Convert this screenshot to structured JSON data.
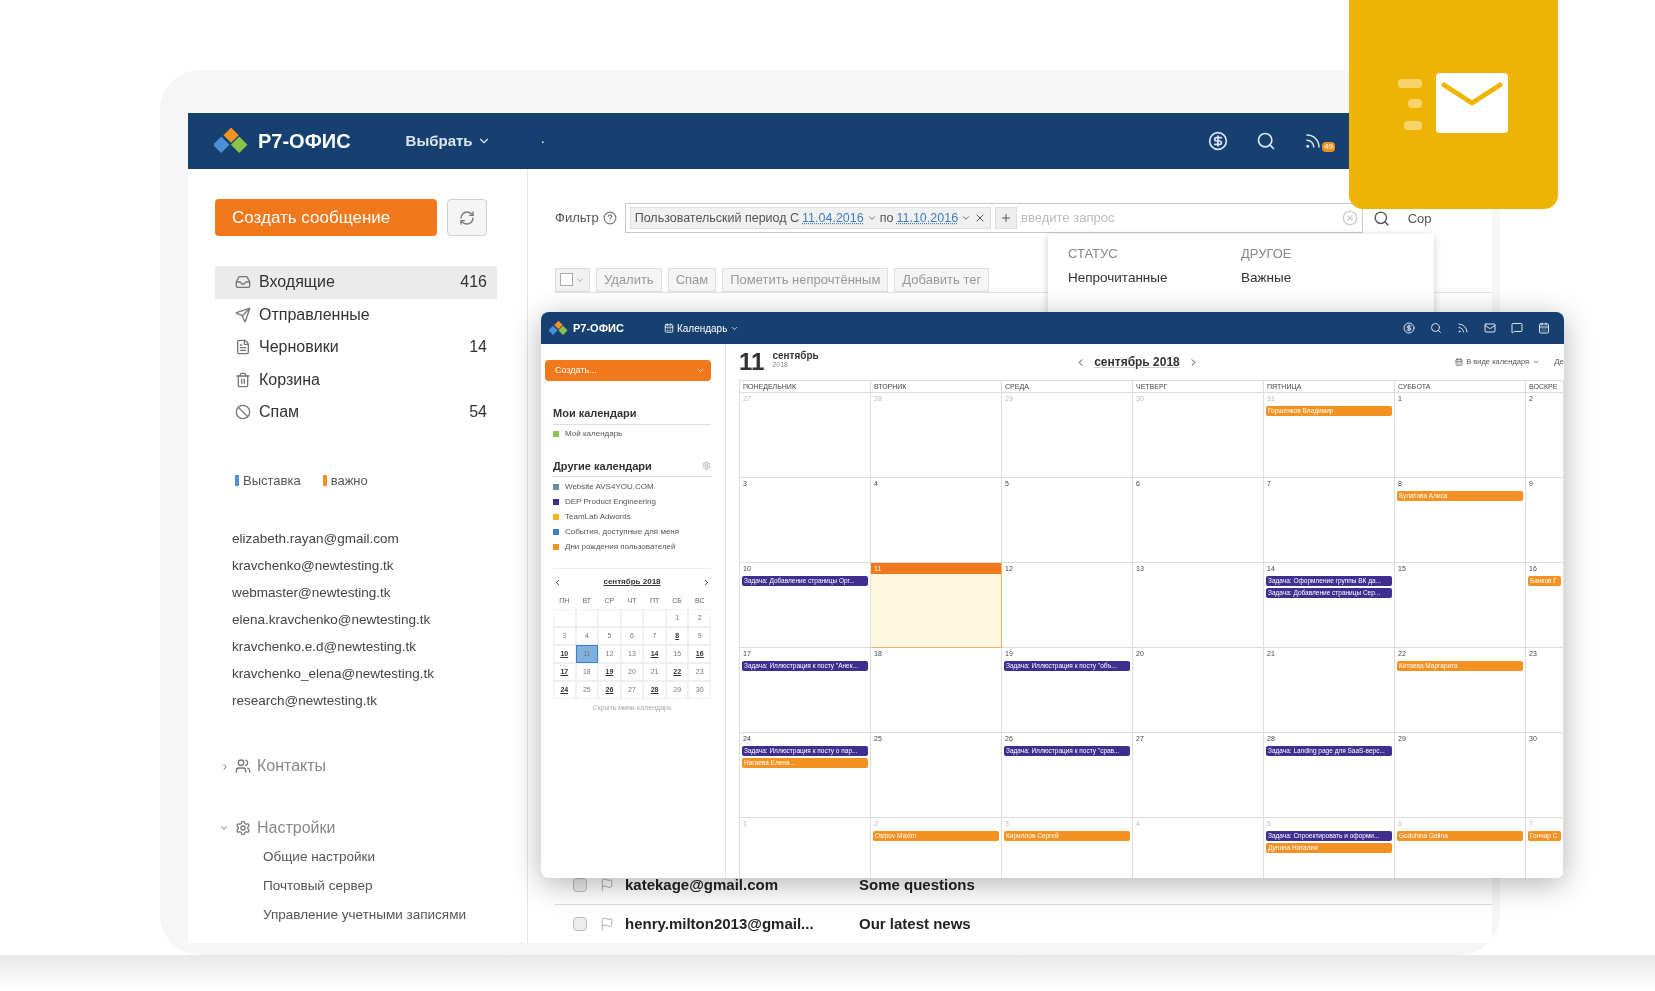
{
  "mail": {
    "header": {
      "logo": "Р7-ОФИС",
      "menu": "Выбрать",
      "dot": "·",
      "feed_badge": "49"
    },
    "sidebar": {
      "create_button": "Создать сообщение",
      "folders": [
        {
          "label": "Входящие",
          "count": "416",
          "selected": true,
          "kind": "inbox"
        },
        {
          "label": "Отправленные",
          "selected": false,
          "kind": "sent"
        },
        {
          "label": "Черновики",
          "count": "14",
          "selected": false,
          "kind": "drafts"
        },
        {
          "label": "Корзина",
          "selected": false,
          "kind": "trash"
        },
        {
          "label": "Спам",
          "count": "54",
          "selected": false,
          "kind": "spam"
        }
      ],
      "tags": [
        {
          "label": "Выставка",
          "color": "#4a90d9"
        },
        {
          "label": "важно",
          "color": "#f39220"
        }
      ],
      "accounts": [
        "elizabeth.rayan@gmail.com",
        "kravchenko@newtesting.tk",
        "webmaster@newtesting.tk",
        "elena.kravchenko@newtesting.tk",
        "kravchenko.e.d@newtesting.tk",
        "kravchenko_elena@newtesting.tk",
        "research@newtesting.tk"
      ],
      "sections": [
        {
          "label": "Контакты",
          "kind": "contacts",
          "expanded": false
        },
        {
          "label": "Настройки",
          "kind": "settings",
          "expanded": true,
          "children": [
            "Общие настройки",
            "Почтовый сервер",
            "Управление учетными записями"
          ]
        }
      ]
    },
    "filter": {
      "label": "Фильтр",
      "period": "Пользовательский период С",
      "from": "11.04.2016",
      "to_label": "по",
      "to": "11.10.2016",
      "placeholder": "введите запрос",
      "sort_label": "Сор"
    },
    "select_all": {
      "checked": false
    },
    "toolbar": [
      "Удалить",
      "Спам",
      "Пометить непрочтённым",
      "Добавить тег"
    ],
    "dropdown": {
      "columns": [
        {
          "title": "СТАТУС",
          "items": [
            "Непрочитанные"
          ]
        },
        {
          "title": "ДРУГОЕ",
          "items": [
            "Важные"
          ]
        }
      ]
    },
    "messages": [
      {
        "sender": "katekage@gmail.com",
        "subject": "Some questions",
        "checked": false
      },
      {
        "sender": "henry.milton2013@gmail...",
        "subject": "Our latest news",
        "checked": false
      }
    ]
  },
  "calendar": {
    "header": {
      "logo": "Р7-ОФИС",
      "menu": "Календарь"
    },
    "create_button": "Создать...",
    "my_calendars": {
      "title": "Мои календари",
      "items": [
        {
          "label": "Мой календарь",
          "color": "#8bc34a"
        }
      ]
    },
    "other_calendars": {
      "title": "Другие календари",
      "items": [
        {
          "label": "Website AVS4YOU.COM",
          "color": "#6b8e9e"
        },
        {
          "label": "DEP Product Engineering",
          "color": "#3f2d8f"
        },
        {
          "label": "TeamLab Adwords",
          "color": "#f5b21b"
        },
        {
          "label": "События, доступные для меня",
          "color": "#3d7fc4"
        },
        {
          "label": "Дни рождения пользователей",
          "color": "#f39220"
        }
      ]
    },
    "mini": {
      "title": "сентябрь 2018",
      "weekdays": [
        "ПН",
        "ВТ",
        "СР",
        "ЧТ",
        "ПТ",
        "СБ",
        "ВС"
      ],
      "weeks": [
        [
          {
            "d": "1",
            "marked": false,
            "selected": false
          },
          {
            "d": "2",
            "marked": false,
            "selected": false
          }
        ],
        [
          {
            "d": "3",
            "marked": false,
            "selected": false
          },
          {
            "d": "4",
            "marked": false,
            "selected": false
          },
          {
            "d": "5",
            "marked": false,
            "selected": false
          },
          {
            "d": "6",
            "marked": false,
            "selected": false
          },
          {
            "d": "7",
            "marked": false,
            "selected": false
          },
          {
            "d": "8",
            "marked": true,
            "selected": false
          },
          {
            "d": "9",
            "marked": false,
            "selected": false
          }
        ],
        [
          {
            "d": "10",
            "marked": true,
            "selected": false
          },
          {
            "d": "11",
            "marked": false,
            "selected": true
          },
          {
            "d": "12",
            "marked": false,
            "selected": false
          },
          {
            "d": "13",
            "marked": false,
            "selected": false
          },
          {
            "d": "14",
            "marked": true,
            "selected": false
          },
          {
            "d": "15",
            "marked": false,
            "selected": false
          },
          {
            "d": "16",
            "marked": true,
            "selected": false
          }
        ],
        [
          {
            "d": "17",
            "marked": true,
            "selected": false
          },
          {
            "d": "18",
            "marked": false,
            "selected": false
          },
          {
            "d": "19",
            "marked": true,
            "selected": false
          },
          {
            "d": "20",
            "marked": false,
            "selected": false
          },
          {
            "d": "21",
            "marked": false,
            "selected": false
          },
          {
            "d": "22",
            "marked": true,
            "selected": false
          },
          {
            "d": "23",
            "marked": false,
            "selected": false
          }
        ],
        [
          {
            "d": "24",
            "marked": true,
            "selected": false
          },
          {
            "d": "25",
            "marked": false,
            "selected": false
          },
          {
            "d": "26",
            "marked": true,
            "selected": false
          },
          {
            "d": "27",
            "marked": false,
            "selected": false
          },
          {
            "d": "28",
            "marked": true,
            "selected": false
          },
          {
            "d": "29",
            "marked": false,
            "selected": false
          },
          {
            "d": "30",
            "marked": false,
            "selected": false
          }
        ]
      ],
      "hide_link": "Скрыть мини-календарь"
    },
    "main": {
      "day": "11",
      "month": "сентябрь",
      "year": "2018",
      "nav_title": "сентябрь 2018",
      "view": "В виде календаря",
      "cut_label": "Де",
      "columns": [
        "ПОНЕДЕЛЬНИК",
        "ВТОРНИК",
        "СРЕДА",
        "ЧЕТВЕРГ",
        "ПЯТНИЦА",
        "СУББОТА",
        "ВОСКРЕ"
      ],
      "weeks": [
        [
          {
            "date": "27",
            "other": true,
            "today": false
          },
          {
            "date": "28",
            "other": true,
            "today": false
          },
          {
            "date": "29",
            "other": true,
            "today": false
          },
          {
            "date": "30",
            "other": true,
            "today": false
          },
          {
            "date": "31",
            "other": true,
            "today": false,
            "events": [
              {
                "text": "Горшенков Владимир",
                "color": "#f39220"
              }
            ]
          },
          {
            "date": "1",
            "other": false,
            "today": false
          },
          {
            "date": "2",
            "other": false,
            "today": false
          }
        ],
        [
          {
            "date": "3",
            "other": false,
            "today": false
          },
          {
            "date": "4",
            "other": false,
            "today": false
          },
          {
            "date": "5",
            "other": false,
            "today": false
          },
          {
            "date": "6",
            "other": false,
            "today": false
          },
          {
            "date": "7",
            "other": false,
            "today": false
          },
          {
            "date": "8",
            "other": false,
            "today": false,
            "events": [
              {
                "text": "Булатова Алиса",
                "color": "#f39220"
              }
            ]
          },
          {
            "date": "9",
            "other": false,
            "today": false
          }
        ],
        [
          {
            "date": "10",
            "other": false,
            "today": false,
            "events": [
              {
                "text": "Задача: Добавление страницы Орг...",
                "color": "#3f2d8f"
              }
            ]
          },
          {
            "date": "11",
            "other": false,
            "today": true
          },
          {
            "date": "12",
            "other": false,
            "today": false
          },
          {
            "date": "13",
            "other": false,
            "today": false
          },
          {
            "date": "14",
            "other": false,
            "today": false,
            "events": [
              {
                "text": "Задача: Оформление группы ВК да...",
                "color": "#3f2d8f"
              },
              {
                "text": "Задача: Добавление страницы Сер...",
                "color": "#3f2d8f"
              }
            ]
          },
          {
            "date": "15",
            "other": false,
            "today": false
          },
          {
            "date": "16",
            "other": false,
            "today": false,
            "events": [
              {
                "text": "Банков Г",
                "color": "#f39220"
              }
            ]
          }
        ],
        [
          {
            "date": "17",
            "other": false,
            "today": false,
            "events": [
              {
                "text": "Задача: Иллюстрация к посту \"Анек...",
                "color": "#3f2d8f"
              }
            ]
          },
          {
            "date": "18",
            "other": false,
            "today": false
          },
          {
            "date": "19",
            "other": false,
            "today": false,
            "events": [
              {
                "text": "Задача: Иллюстрация к посту \"объ...",
                "color": "#3f2d8f"
              }
            ]
          },
          {
            "date": "20",
            "other": false,
            "today": false
          },
          {
            "date": "21",
            "other": false,
            "today": false
          },
          {
            "date": "22",
            "other": false,
            "today": false,
            "events": [
              {
                "text": "Китаева Маргарита",
                "color": "#f39220"
              }
            ]
          },
          {
            "date": "23",
            "other": false,
            "today": false
          }
        ],
        [
          {
            "date": "24",
            "other": false,
            "today": false,
            "events": [
              {
                "text": "Задача: Иллюстрация к посту о пар...",
                "color": "#3f2d8f"
              },
              {
                "text": "Нагаева Елена...",
                "color": "#f39220"
              }
            ]
          },
          {
            "date": "25",
            "other": false,
            "today": false
          },
          {
            "date": "26",
            "other": false,
            "today": false,
            "events": [
              {
                "text": "Задача: Иллюстрация к посту \"срав...",
                "color": "#3f2d8f"
              }
            ]
          },
          {
            "date": "27",
            "other": false,
            "today": false
          },
          {
            "date": "28",
            "other": false,
            "today": false,
            "events": [
              {
                "text": "Задача: Landing page для SaaS-верс...",
                "color": "#3f2d8f"
              }
            ]
          },
          {
            "date": "29",
            "other": false,
            "today": false
          },
          {
            "date": "30",
            "other": false,
            "today": false
          }
        ],
        [
          {
            "date": "1",
            "other": true,
            "today": false
          },
          {
            "date": "2",
            "other": true,
            "today": false,
            "events": [
              {
                "text": "Osipov Maxim",
                "color": "#f39220"
              }
            ]
          },
          {
            "date": "3",
            "other": true,
            "today": false,
            "events": [
              {
                "text": "Кириллов Сергей",
                "color": "#f39220"
              }
            ]
          },
          {
            "date": "4",
            "other": true,
            "today": false
          },
          {
            "date": "5",
            "other": true,
            "today": false,
            "events": [
              {
                "text": "Задача: Спроектировать и оформи...",
                "color": "#3f2d8f"
              },
              {
                "text": "Дунина Наталия",
                "color": "#f39220"
              }
            ]
          },
          {
            "date": "6",
            "other": true,
            "today": false,
            "events": [
              {
                "text": "Goduhina Galina",
                "color": "#f39220"
              }
            ]
          },
          {
            "date": "7",
            "other": true,
            "today": false,
            "events": [
              {
                "text": "Гончар С",
                "color": "#f39220"
              }
            ]
          }
        ]
      ]
    }
  }
}
